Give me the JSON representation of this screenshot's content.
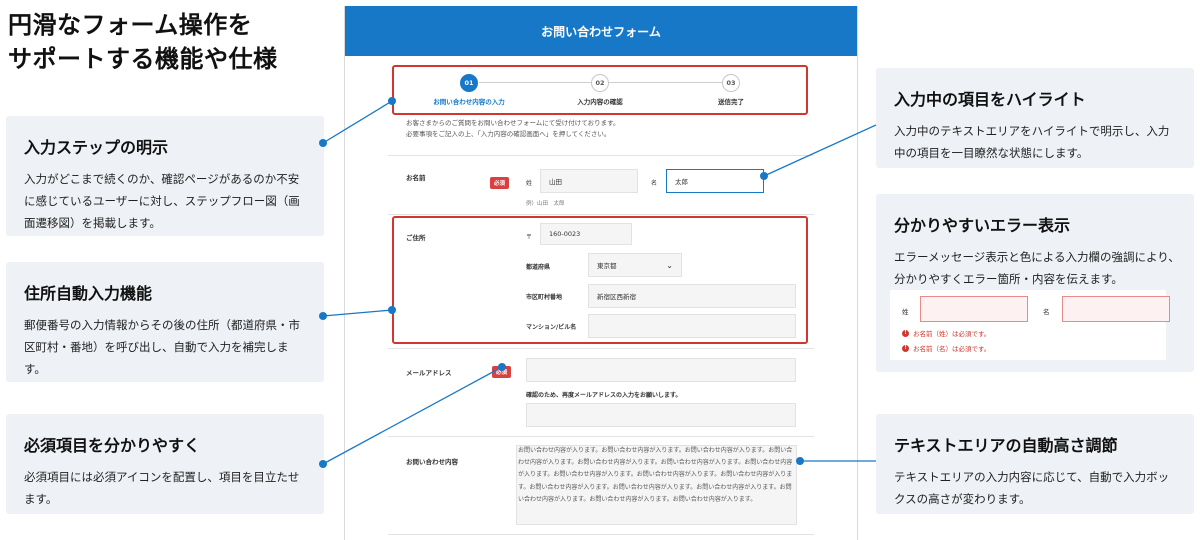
{
  "headline": {
    "line1": "円滑なフォーム操作を",
    "line2": "サポートする機能や仕様"
  },
  "cards": {
    "steps": {
      "title": "入力ステップの明示",
      "desc": "入力がどこまで続くのか、確認ページがあるのか不安に感じているユーザーに対し、ステップフロー図（画面遷移図）を掲載します。"
    },
    "address": {
      "title": "住所自動入力機能",
      "desc": "郵便番号の入力情報からその後の住所（都道府県・市区町村・番地）を呼び出し、自動で入力を補完します。"
    },
    "required": {
      "title": "必須項目を分かりやすく",
      "desc": "必須項目には必須アイコンを配置し、項目を目立たせます。"
    },
    "highlight": {
      "title": "入力中の項目をハイライト",
      "desc": "入力中のテキストエリアをハイライトで明示し、入力中の項目を一目瞭然な状態にします。"
    },
    "error": {
      "title": "分かりやすいエラー表示",
      "desc": "エラーメッセージ表示と色による入力欄の強調により、分かりやすくエラー箇所・内容を伝えます。"
    },
    "textarea": {
      "title": "テキストエリアの自動高さ調節",
      "desc": "テキストエリアの入力内容に応じて、自動で入力ボックスの高さが変わります。"
    }
  },
  "form": {
    "header": "お問い合わせフォーム",
    "steps": [
      {
        "num": "01",
        "label": "お問い合わせ内容の入力"
      },
      {
        "num": "02",
        "label": "入力内容の確認"
      },
      {
        "num": "03",
        "label": "送信完了"
      }
    ],
    "intro_line1": "お客さまからのご質問をお問い合わせフォームにて受け付けております。",
    "intro_line2": "必要事項をご記入の上、「入力内容の確認画面へ」を押してください。",
    "name": {
      "label": "お名前",
      "required": "必須",
      "sei_label": "姓",
      "sei_value": "山田",
      "mei_label": "名",
      "mei_value": "太郎",
      "example": "例）山田　太郎"
    },
    "address": {
      "label": "ご住所",
      "zip_mark": "〒",
      "zip_value": "160-0023",
      "pref_label": "都道府県",
      "pref_value": "東京都",
      "city_label": "市区町村番地",
      "city_value": "新宿区西新宿",
      "building_label": "マンション/ビル名"
    },
    "email": {
      "label": "メールアドレス",
      "required": "必須",
      "confirm_note": "確認のため、再度メールアドレスの入力をお願いします。"
    },
    "inquiry": {
      "label": "お問い合わせ内容",
      "text": "お問い合わせ内容が入ります。お問い合わせ内容が入ります。お問い合わせ内容が入ります。お問い合わせ内容が入ります。お問い合わせ内容が入ります。お問い合わせ内容が入ります。お問い合わせ内容が入ります。お問い合わせ内容が入ります。お問い合わせ内容が入ります。お問い合わせ内容が入ります。お問い合わせ内容が入ります。お問い合わせ内容が入ります。お問い合わせ内容が入ります。お問い合わせ内容が入ります。お問い合わせ内容が入ります。お問い合わせ内容が入ります。"
    }
  },
  "error_sample": {
    "sei_label": "姓",
    "mei_label": "名",
    "msg1": "お名前（姓）は必須です。",
    "msg2": "お名前（名）は必須です。",
    "icon": "!"
  },
  "colors": {
    "accent": "#1778c8",
    "error": "#d0372e",
    "card_bg": "#eef1f5"
  }
}
